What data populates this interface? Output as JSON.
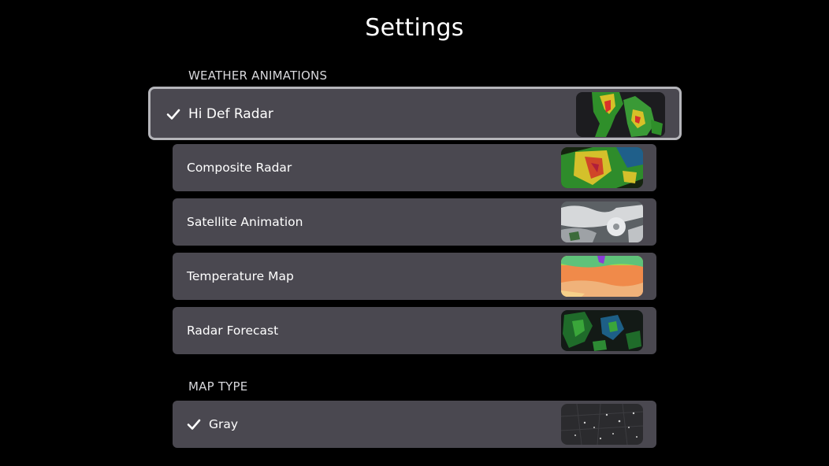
{
  "page": {
    "title": "Settings"
  },
  "sections": {
    "weather_animations": {
      "header": "WEATHER ANIMATIONS",
      "items": [
        {
          "label": "Hi Def Radar",
          "selected": true,
          "thumbnail": "hi-def-radar-thumbnail"
        },
        {
          "label": "Composite Radar",
          "selected": false,
          "thumbnail": "composite-radar-thumbnail"
        },
        {
          "label": "Satellite Animation",
          "selected": false,
          "thumbnail": "satellite-thumbnail"
        },
        {
          "label": "Temperature Map",
          "selected": false,
          "thumbnail": "temperature-map-thumbnail"
        },
        {
          "label": "Radar Forecast",
          "selected": false,
          "thumbnail": "radar-forecast-thumbnail"
        }
      ]
    },
    "map_type": {
      "header": "MAP TYPE",
      "items": [
        {
          "label": "Gray",
          "selected": true,
          "thumbnail": "gray-map-thumbnail"
        }
      ]
    }
  },
  "icons": {
    "selected_indicator": "checkmark-icon"
  },
  "colors": {
    "background": "#000000",
    "row_background": "#4a4850",
    "focus_border": "#b5b5ba",
    "header_text": "#d8d8dc",
    "text": "#ffffff"
  }
}
